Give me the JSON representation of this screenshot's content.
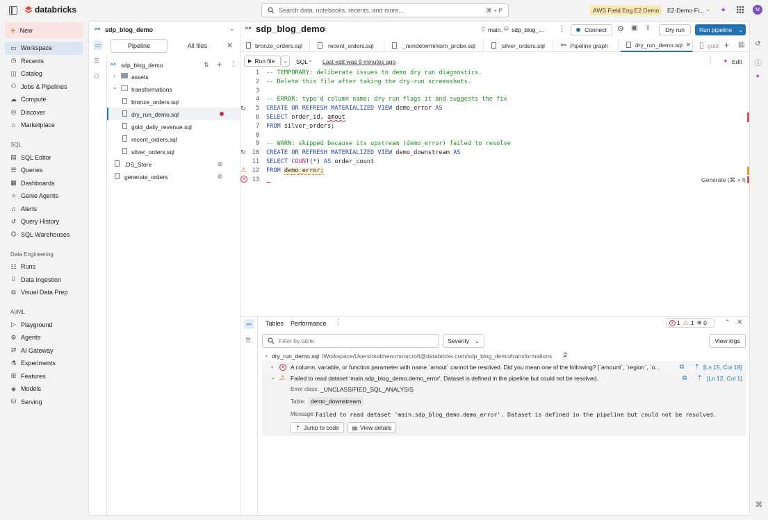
{
  "topbar": {
    "brand": "databricks",
    "search_placeholder": "Search data, notebooks, recents, and more...",
    "search_shortcut": "⌘ + P",
    "workspace_badge": "AWS Field Eng E2 Demo",
    "workspace_selector": "E2-Demo-Fi..."
  },
  "nav": {
    "new_label": "New",
    "items": [
      {
        "label": "Workspace",
        "icon": "folder-icon"
      },
      {
        "label": "Recents",
        "icon": "clock-icon"
      },
      {
        "label": "Catalog",
        "icon": "catalog-icon"
      },
      {
        "label": "Jobs & Pipelines",
        "icon": "jobs-icon"
      },
      {
        "label": "Compute",
        "icon": "cloud-icon"
      },
      {
        "label": "Discover",
        "icon": "discover-icon"
      },
      {
        "label": "Marketplace",
        "icon": "store-icon"
      }
    ],
    "sql_section": "SQL",
    "sql_items": [
      {
        "label": "SQL Editor"
      },
      {
        "label": "Queries"
      },
      {
        "label": "Dashboards"
      },
      {
        "label": "Genie Agents"
      },
      {
        "label": "Alerts"
      },
      {
        "label": "Query History"
      },
      {
        "label": "SQL Warehouses"
      }
    ],
    "de_section": "Data Engineering",
    "de_items": [
      {
        "label": "Runs"
      },
      {
        "label": "Data Ingestion"
      },
      {
        "label": "Visual Data Prep"
      }
    ],
    "ai_section": "AI/ML",
    "ai_items": [
      {
        "label": "Playground"
      },
      {
        "label": "Agents"
      },
      {
        "label": "AI Gateway"
      },
      {
        "label": "Experiments"
      },
      {
        "label": "Features"
      },
      {
        "label": "Models"
      },
      {
        "label": "Serving"
      }
    ]
  },
  "pipeline": {
    "selector_name": "sdp_blog_demo",
    "title": "sdp_blog_demo",
    "catalog": "main",
    "schema": "sdp_blog_...",
    "connect_label": "Connect",
    "dry_run_label": "Dry run",
    "run_label": "Run pipeline"
  },
  "browser": {
    "tab_pipeline": "Pipeline",
    "tab_all_files": "All files",
    "root": "sdp_blog_demo",
    "items": [
      {
        "label": "assets"
      },
      {
        "label": "transformations"
      },
      {
        "label": "bronze_orders.sql"
      },
      {
        "label": "dry_run_demo.sql"
      },
      {
        "label": "gold_daily_revenue.sql"
      },
      {
        "label": "recent_orders.sql"
      },
      {
        "label": "silver_orders.sql"
      },
      {
        "label": ".DS_Store"
      },
      {
        "label": "generate_orders"
      }
    ]
  },
  "tabs": [
    {
      "label": "bronze_orders.sql"
    },
    {
      "label": "recent_orders.sql"
    },
    {
      "label": "_nondeterminism_probe.sql"
    },
    {
      "label": "silver_orders.sql"
    },
    {
      "label": "Pipeline graph"
    },
    {
      "label": "dry_run_demo.sql"
    },
    {
      "label": "gold"
    }
  ],
  "editor": {
    "run_file_label": "Run file",
    "language": "SQL",
    "last_edit": "Last edit was 9 minutes ago",
    "edit_label": "Edit",
    "generate_hint": "Generate (⌘ + I)",
    "lines": [
      {
        "n": "1",
        "parts": [
          {
            "t": "-- TEMPORARY: deliberate issues to demo dry run diagnostics.",
            "c": "cm"
          }
        ]
      },
      {
        "n": "2",
        "parts": [
          {
            "t": "-- Delete this file after taking the dry-run screenshots.",
            "c": "cm"
          }
        ]
      },
      {
        "n": "3",
        "parts": []
      },
      {
        "n": "4",
        "parts": [
          {
            "t": "-- ERROR: typo'd column name; dry run flags it and suggests the fix",
            "c": "cm"
          }
        ]
      },
      {
        "n": "5",
        "parts": [
          {
            "t": "CREATE OR REFRESH MATERIALIZED VIEW ",
            "c": "kw"
          },
          {
            "t": "demo_error ",
            "c": ""
          },
          {
            "t": "AS",
            "c": "kw"
          }
        ]
      },
      {
        "n": "6",
        "parts": [
          {
            "t": "SELECT ",
            "c": "kw"
          },
          {
            "t": "order_id, ",
            "c": ""
          },
          {
            "t": "amout",
            "c": "err"
          }
        ]
      },
      {
        "n": "7",
        "parts": [
          {
            "t": "FROM ",
            "c": "kw"
          },
          {
            "t": "silver_orders;",
            "c": ""
          }
        ]
      },
      {
        "n": "8",
        "parts": []
      },
      {
        "n": "9",
        "parts": [
          {
            "t": "-- WARN: skipped because its upstream (demo_error) failed to resolve",
            "c": "cm"
          }
        ]
      },
      {
        "n": "10",
        "parts": [
          {
            "t": "CREATE OR REFRESH MATERIALIZED VIEW ",
            "c": "kw"
          },
          {
            "t": "demo_downstream ",
            "c": ""
          },
          {
            "t": "AS",
            "c": "kw"
          }
        ]
      },
      {
        "n": "11",
        "parts": [
          {
            "t": "SELECT ",
            "c": "kw"
          },
          {
            "t": "COUNT",
            "c": "fn"
          },
          {
            "t": "(*) ",
            "c": ""
          },
          {
            "t": "AS ",
            "c": "kw"
          },
          {
            "t": "order_count",
            "c": ""
          }
        ]
      },
      {
        "n": "12",
        "parts": [
          {
            "t": "FROM ",
            "c": "kw"
          },
          {
            "t": "demo_error;",
            "c": "warn"
          }
        ]
      },
      {
        "n": "13",
        "parts": []
      }
    ]
  },
  "issues": {
    "tab_tables": "Tables",
    "tab_performance": "Performance",
    "error_count": "1",
    "warn_count": "1",
    "info_count": "0",
    "filter_placeholder": "Filter by table",
    "severity_label": "Severity",
    "view_logs_label": "View logs",
    "file_name": "dry_run_demo.sql",
    "file_path": "/Workspace/Users/matthew.moorcroft@databricks.com/sdp_blog_demo/transformations",
    "file_count": "2",
    "error_message": "A column, variable, or function parameter with name `amout` cannot be resolved. Did you mean one of the following? [`amount`, `region`, `o...",
    "error_location": "[Ln 15, Col 18]",
    "warn_message": "Failed to read dataset 'main.sdp_blog_demo.demo_error'. Dataset is defined in the pipeline but could not be resolved.",
    "warn_location": "[Ln 12, Col 1]",
    "error_class_label": "Error class:",
    "error_class_value": "_UNCLASSIFIED_SQL_ANALYSIS",
    "table_label": "Table:",
    "table_value": "demo_downstream",
    "message_label": "Message:",
    "message_value": "Failed to read dataset 'main.sdp_blog_demo.demo_error'. Dataset is defined in the pipeline but could not be resolved.",
    "jump_label": "Jump to code",
    "details_label": "View details"
  },
  "colors": {
    "brand": "#e8432e",
    "primary": "#2272b4",
    "error": "#c6283a",
    "warning": "#c77a1a",
    "comment": "#1e8f1e",
    "keyword": "#2647b8"
  }
}
